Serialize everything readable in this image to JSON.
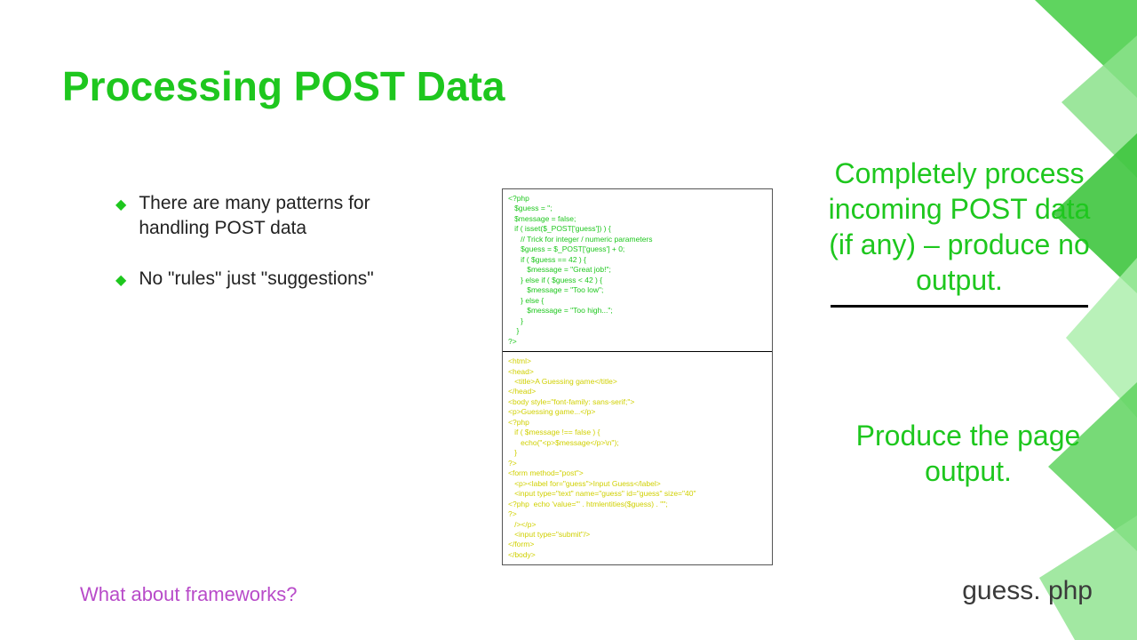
{
  "title": "Processing POST Data",
  "bullets": [
    "There are many patterns for handling POST data",
    "No \"rules\" just \"suggestions\""
  ],
  "footer": "What about frameworks?",
  "code_top": "<?php\n   $guess = '';\n   $message = false;\n   if ( isset($_POST['guess']) ) {\n      // Trick for integer / numeric parameters\n      $guess = $_POST['guess'] + 0;\n      if ( $guess == 42 ) {\n         $message = \"Great job!\";\n      } else if ( $guess < 42 ) {\n         $message = \"Too low\";\n      } else {\n         $message = \"Too high...\";\n      }\n    }\n?>",
  "code_bottom": "<html>\n<head>\n   <title>A Guessing game</title>\n</head>\n<body style=\"font-family: sans-serif;\">\n<p>Guessing game...</p>\n<?php\n   if ( $message !== false ) {\n      echo(\"<p>$message</p>\\n\");\n   }\n?>\n<form method=\"post\">\n   <p><label for=\"guess\">Input Guess</label>\n   <input type=\"text\" name=\"guess\" id=\"guess\" size=\"40\"\n<?php  echo 'value=\"' . htmlentities($guess) . '\"';\n?>\n   /></p>\n   <input type=\"submit\"/>\n</form>\n</body>",
  "annot_top": "Completely process incoming POST data (if any) – produce no output.",
  "annot_bottom": "Produce the page output.",
  "filename": "guess. php"
}
